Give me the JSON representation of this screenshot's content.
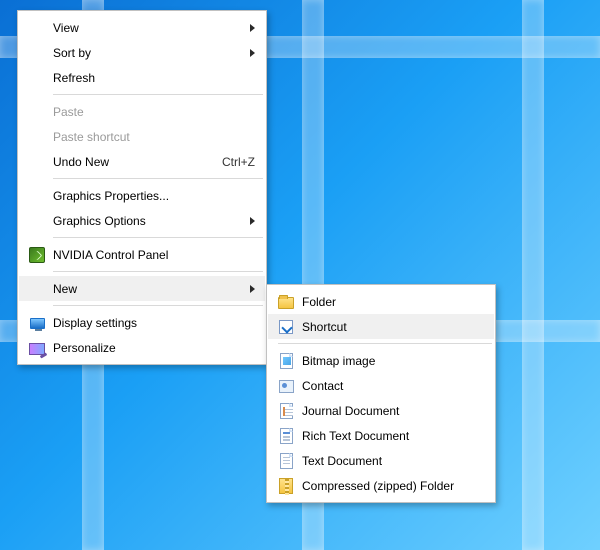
{
  "main_menu": {
    "view": {
      "label": "View",
      "submenu": true
    },
    "sort_by": {
      "label": "Sort by",
      "submenu": true
    },
    "refresh": {
      "label": "Refresh"
    },
    "paste": {
      "label": "Paste",
      "disabled": true
    },
    "paste_shortcut": {
      "label": "Paste shortcut",
      "disabled": true
    },
    "undo_new": {
      "label": "Undo New",
      "accel": "Ctrl+Z"
    },
    "graphics_props": {
      "label": "Graphics Properties..."
    },
    "graphics_opts": {
      "label": "Graphics Options",
      "submenu": true
    },
    "nvidia": {
      "label": "NVIDIA Control Panel",
      "icon": "nvidia-icon"
    },
    "new": {
      "label": "New",
      "submenu": true,
      "highlighted": true
    },
    "display_settings": {
      "label": "Display settings",
      "icon": "monitor-icon"
    },
    "personalize": {
      "label": "Personalize",
      "icon": "personalize-icon"
    }
  },
  "sub_menu": {
    "folder": {
      "label": "Folder",
      "icon": "folder-icon"
    },
    "shortcut": {
      "label": "Shortcut",
      "icon": "shortcut-icon",
      "highlighted": true
    },
    "bitmap": {
      "label": "Bitmap image",
      "icon": "bitmap-icon"
    },
    "contact": {
      "label": "Contact",
      "icon": "contact-icon"
    },
    "journal": {
      "label": "Journal Document",
      "icon": "journal-icon"
    },
    "rtf": {
      "label": "Rich Text Document",
      "icon": "rtf-icon"
    },
    "text": {
      "label": "Text Document",
      "icon": "text-icon"
    },
    "zip": {
      "label": "Compressed (zipped) Folder",
      "icon": "zip-icon"
    }
  }
}
